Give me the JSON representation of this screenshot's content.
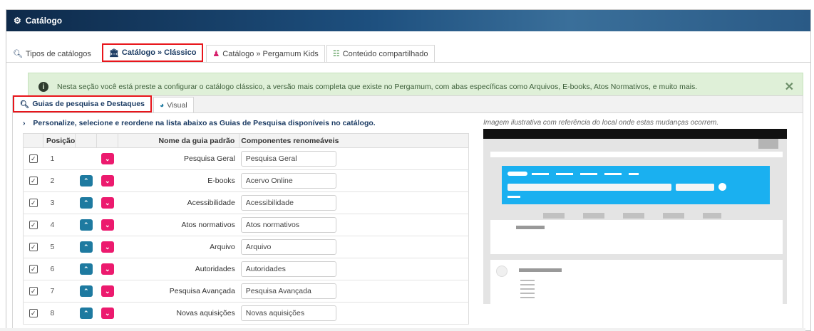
{
  "app": {
    "title": "Catálogo",
    "title_icon": "gears-icon"
  },
  "tabs": [
    {
      "label": "Tipos de catálogos",
      "icon": "search-icon",
      "active": false
    },
    {
      "label": "Catálogo » Clássico",
      "icon": "institution-icon",
      "active": true
    },
    {
      "label": "Catálogo » Pergamum Kids",
      "icon": "kids-icon",
      "active": false
    },
    {
      "label": "Conteúdo compartilhado",
      "icon": "sitemap-icon",
      "active": false
    }
  ],
  "alert": {
    "message": "Nesta seção você está preste a configurar o catálogo clássico, a versão mais completa que existe no Pergamum, com abas específicas como Arquivos, E-books, Atos Normativos, e muito mais.",
    "close_label": "✕"
  },
  "subtabs": [
    {
      "label": "Guias de pesquisa e Destaques",
      "icon": "search-icon",
      "active": true
    },
    {
      "label": "Visual",
      "icon": "palette-icon",
      "active": false
    }
  ],
  "section": {
    "heading": "Personalize, selecione e reordene na lista abaixo as Guias de Pesquisa disponíveis no catálogo."
  },
  "table": {
    "headers": {
      "position": "Posição",
      "name": "Nome da guia padrão",
      "components": "Componentes renomeáveis"
    },
    "rows": [
      {
        "pos": "1",
        "name": "Pesquisa Geral",
        "value": "Pesquisa Geral",
        "checked": true,
        "has_up": false
      },
      {
        "pos": "2",
        "name": "E-books",
        "value": "Acervo Online",
        "checked": true,
        "has_up": true
      },
      {
        "pos": "3",
        "name": "Acessibilidade",
        "value": "Acessibilidade",
        "checked": true,
        "has_up": true
      },
      {
        "pos": "4",
        "name": "Atos normativos",
        "value": "Atos normativos",
        "checked": true,
        "has_up": true
      },
      {
        "pos": "5",
        "name": "Arquivo",
        "value": "Arquivo",
        "checked": true,
        "has_up": true
      },
      {
        "pos": "6",
        "name": "Autoridades",
        "value": "Autoridades",
        "checked": true,
        "has_up": true
      },
      {
        "pos": "7",
        "name": "Pesquisa Avançada",
        "value": "Pesquisa Avançada",
        "checked": true,
        "has_up": true
      },
      {
        "pos": "8",
        "name": "Novas aquisições",
        "value": "Novas aquisições",
        "checked": true,
        "has_up": true
      }
    ]
  },
  "illustration": {
    "caption": "Imagem ilustrativa com referência do local onde estas mudanças ocorrem."
  }
}
